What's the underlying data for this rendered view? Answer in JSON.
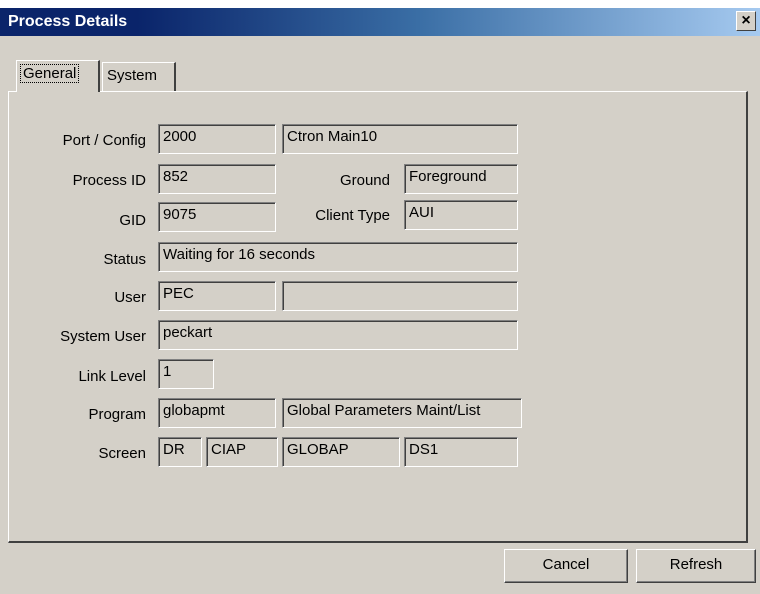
{
  "window": {
    "title": "Process Details",
    "close": "×"
  },
  "tabs": [
    {
      "label": "General",
      "active": true
    },
    {
      "label": "System",
      "active": false
    }
  ],
  "fields": {
    "port_config": {
      "label": "Port / Config",
      "port": "2000",
      "config": "Ctron Main10"
    },
    "process_id": {
      "label": "Process ID",
      "value": "852"
    },
    "ground": {
      "label": "Ground",
      "value": "Foreground"
    },
    "gid": {
      "label": "GID",
      "value": "9075"
    },
    "client_type": {
      "label": "Client Type",
      "value": "AUI"
    },
    "status": {
      "label": "Status",
      "value": "Waiting for 16 seconds"
    },
    "user": {
      "label": "User",
      "value": "PEC",
      "extra": ""
    },
    "system_user": {
      "label": "System User",
      "value": "peckart"
    },
    "link_level": {
      "label": "Link Level",
      "value": "1"
    },
    "program": {
      "label": "Program",
      "code": "globapmt",
      "description": "Global Parameters Maint/List"
    },
    "screen": {
      "label": "Screen",
      "values": [
        "DR",
        "CIAP",
        "GLOBAP",
        "DS1"
      ]
    }
  },
  "buttons": {
    "cancel": "Cancel",
    "refresh": "Refresh"
  }
}
